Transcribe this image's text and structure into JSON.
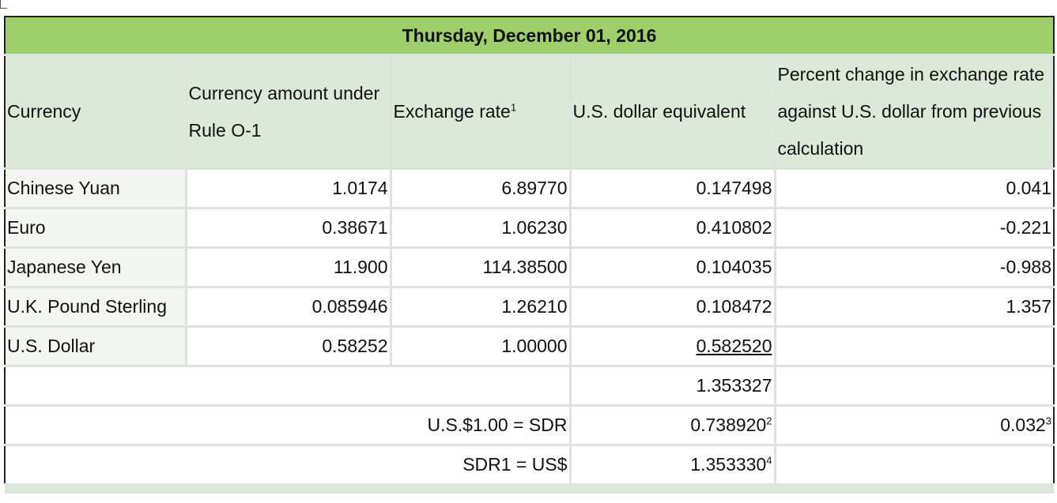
{
  "title": "Thursday, December 01, 2016",
  "headers": {
    "currency": "Currency",
    "amount": "Currency amount under Rule O-1",
    "rate": "Exchange rate",
    "rate_note": "1",
    "usd_equiv": "U.S. dollar equivalent",
    "pct_change": "Percent change in exchange rate against U.S. dollar from previous calculation"
  },
  "rows": [
    {
      "currency": "Chinese Yuan",
      "amount": "1.0174",
      "rate": "6.89770",
      "usd": "0.147498",
      "pct": "0.041"
    },
    {
      "currency": "Euro",
      "amount": "0.38671",
      "rate": "1.06230",
      "usd": "0.410802",
      "pct": "-0.221"
    },
    {
      "currency": "Japanese Yen",
      "amount": "11.900",
      "rate": "114.38500",
      "usd": "0.104035",
      "pct": "-0.988"
    },
    {
      "currency": "U.K. Pound Sterling",
      "amount": "0.085946",
      "rate": "1.26210",
      "usd": "0.108472",
      "pct": "1.357"
    },
    {
      "currency": "U.S. Dollar",
      "amount": "0.58252",
      "rate": "1.00000",
      "usd": "0.582520",
      "pct": ""
    }
  ],
  "total": "1.353327",
  "sdr_per_usd": {
    "label": "U.S.$1.00 = SDR",
    "value": "0.738920",
    "value_note": "2",
    "pct": "0.032",
    "pct_note": "3"
  },
  "usd_per_sdr": {
    "label": "SDR1 = US$",
    "value": "1.353330",
    "value_note": "4"
  }
}
